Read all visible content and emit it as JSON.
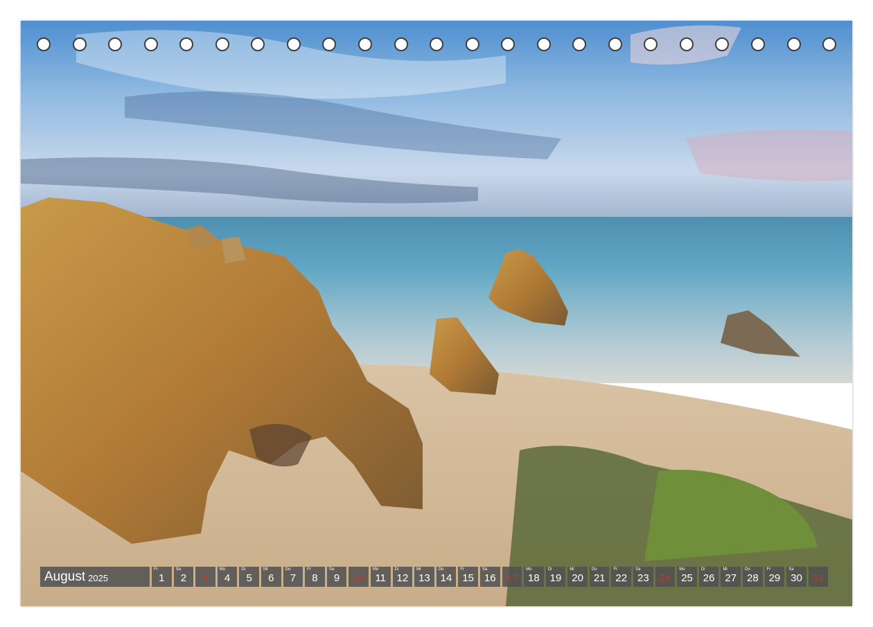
{
  "calendar": {
    "month": "August",
    "year": "2025",
    "ring_count": 23,
    "colors": {
      "strip": "#505050",
      "sunday": "#c0392b",
      "text": "#ffffff"
    },
    "days": [
      {
        "wd": "Fr",
        "n": "1"
      },
      {
        "wd": "Sa",
        "n": "2"
      },
      {
        "wd": "",
        "n": "3",
        "sun": true
      },
      {
        "wd": "Mo",
        "n": "4"
      },
      {
        "wd": "Di",
        "n": "5"
      },
      {
        "wd": "Mi",
        "n": "6"
      },
      {
        "wd": "Do",
        "n": "7"
      },
      {
        "wd": "Fr",
        "n": "8"
      },
      {
        "wd": "Sa",
        "n": "9"
      },
      {
        "wd": "",
        "n": "10",
        "sun": true
      },
      {
        "wd": "Mo",
        "n": "11"
      },
      {
        "wd": "Di",
        "n": "12"
      },
      {
        "wd": "Mi",
        "n": "13"
      },
      {
        "wd": "Do",
        "n": "14"
      },
      {
        "wd": "Fr",
        "n": "15"
      },
      {
        "wd": "Sa",
        "n": "16"
      },
      {
        "wd": "",
        "n": "17",
        "sun": true
      },
      {
        "wd": "Mo",
        "n": "18"
      },
      {
        "wd": "Di",
        "n": "19"
      },
      {
        "wd": "Mi",
        "n": "20"
      },
      {
        "wd": "Do",
        "n": "21"
      },
      {
        "wd": "Fr",
        "n": "22"
      },
      {
        "wd": "Sa",
        "n": "23"
      },
      {
        "wd": "",
        "n": "24",
        "sun": true
      },
      {
        "wd": "Mo",
        "n": "25"
      },
      {
        "wd": "Di",
        "n": "26"
      },
      {
        "wd": "Mi",
        "n": "27"
      },
      {
        "wd": "Do",
        "n": "28"
      },
      {
        "wd": "Fr",
        "n": "29"
      },
      {
        "wd": "Sa",
        "n": "30"
      },
      {
        "wd": "",
        "n": "31",
        "sun": true
      }
    ]
  }
}
